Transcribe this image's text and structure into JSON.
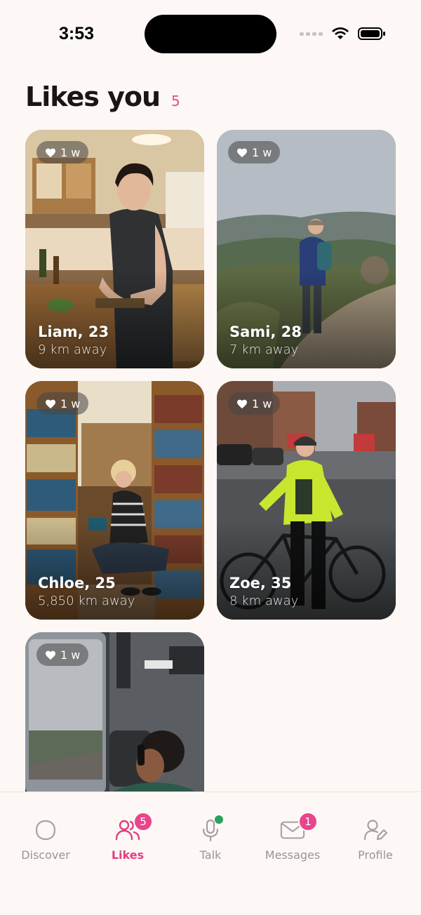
{
  "status": {
    "time": "3:53"
  },
  "header": {
    "title": "Likes you",
    "count": "5"
  },
  "likes": [
    {
      "name": "Liam, 23",
      "distance": "9 km away",
      "time": "1 w"
    },
    {
      "name": "Sami, 28",
      "distance": "7 km away",
      "time": "1 w"
    },
    {
      "name": "Chloe, 25",
      "distance": "5,850 km away",
      "time": "1 w"
    },
    {
      "name": "Zoe, 35",
      "distance": "8 km away",
      "time": "1 w"
    },
    {
      "name": "",
      "distance": "",
      "time": "1 w"
    }
  ],
  "nav": {
    "items": [
      {
        "label": "Discover",
        "icon": "discover-icon"
      },
      {
        "label": "Likes",
        "icon": "likes-icon",
        "badge": "5"
      },
      {
        "label": "Talk",
        "icon": "microphone-icon"
      },
      {
        "label": "Messages",
        "icon": "envelope-icon",
        "badge": "1"
      },
      {
        "label": "Profile",
        "icon": "profile-icon"
      }
    ]
  },
  "colors": {
    "accent": "#e33c80",
    "badge": "#e8458c",
    "background": "#fdf8f5",
    "online_dot": "#27a35b"
  }
}
